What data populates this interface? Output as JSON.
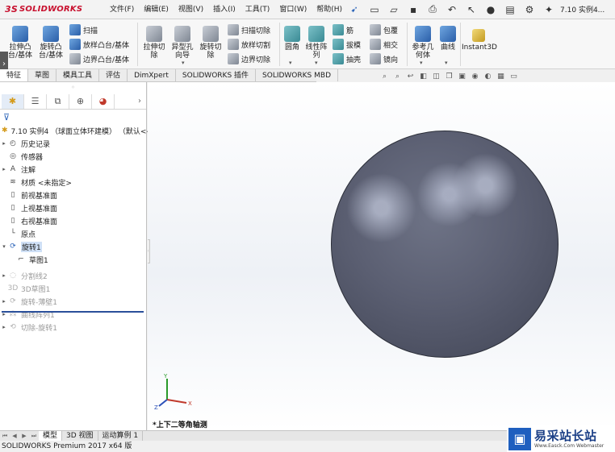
{
  "app": {
    "logo_prefix": "3S",
    "logo_name": "SOLIDWORKS",
    "document_title": "7.10 实例4..."
  },
  "menu": [
    {
      "label": "文件(F)"
    },
    {
      "label": "编辑(E)"
    },
    {
      "label": "视图(V)"
    },
    {
      "label": "插入(I)"
    },
    {
      "label": "工具(T)"
    },
    {
      "label": "窗口(W)"
    },
    {
      "label": "帮助(H)"
    }
  ],
  "commands": {
    "extrude_boss": "拉伸凸\n台/基体",
    "revolve_boss": "旋转凸\n台/基体",
    "sweep": "扫描",
    "loft_boss": "放样凸台/基体",
    "boundary_boss": "边界凸台/基体",
    "extrude_cut": "拉伸切\n除",
    "hole_wizard": "异型孔\n向导",
    "revolve_cut": "旋转切\n除",
    "swept_cut": "扫描切除",
    "lofted_cut": "放样切割",
    "boundary_cut": "边界切除",
    "fillet": "圆角",
    "linear_pattern": "线性阵\n列",
    "rib": "筋",
    "draft": "拔模",
    "shell": "抽壳",
    "wrap": "包覆",
    "intersect": "相交",
    "mirror": "镜向",
    "ref_geometry": "参考几\n何体",
    "curves": "曲线",
    "instant3d": "Instant3D"
  },
  "tabs": [
    {
      "label": "特征",
      "active": true
    },
    {
      "label": "草图"
    },
    {
      "label": "模具工具"
    },
    {
      "label": "评估"
    },
    {
      "label": "DimXpert"
    },
    {
      "label": "SOLIDWORKS 插件"
    },
    {
      "label": "SOLIDWORKS MBD"
    }
  ],
  "tree": {
    "root": "7.10 实例4 （球面立体环建模） （默认<<",
    "items": [
      {
        "label": "历史记录",
        "expandable": true
      },
      {
        "label": "传感器"
      },
      {
        "label": "注解",
        "expandable": true
      },
      {
        "label": "材质 <未指定>"
      },
      {
        "label": "前视基准面"
      },
      {
        "label": "上视基准面"
      },
      {
        "label": "右视基准面"
      },
      {
        "label": "原点"
      },
      {
        "label": "旋转1",
        "expandable": true,
        "selected": true
      },
      {
        "label": "草图1"
      },
      {
        "label": "分割线2",
        "dim": true
      },
      {
        "label": "3D草图1",
        "dim": true
      },
      {
        "label": "旋转-薄壁1",
        "dim": true
      },
      {
        "label": "曲线阵列1",
        "dim": true
      },
      {
        "label": "切除-旋转1",
        "dim": true
      }
    ]
  },
  "viewport": {
    "view_name": "*上下二等角轴测",
    "triad_axes": [
      "Y",
      "X",
      "Z"
    ]
  },
  "bottom_tabs": [
    {
      "label": "模型",
      "active": true
    },
    {
      "label": "3D 视图"
    },
    {
      "label": "运动算例 1"
    }
  ],
  "status": {
    "text": "SOLIDWORKS Premium 2017 x64 版"
  },
  "watermark": {
    "title": "易采站长站",
    "url": "Www.Easck.Com Webmaster"
  }
}
